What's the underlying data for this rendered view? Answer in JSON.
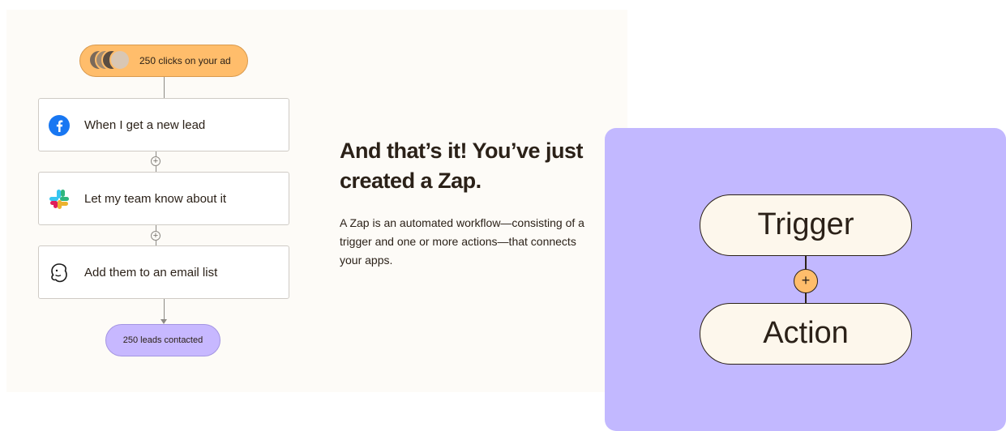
{
  "flow": {
    "trigger_pill": "250 clicks on your ad",
    "steps": [
      {
        "label": "When I get a new lead",
        "icon": "facebook-icon"
      },
      {
        "label": "Let my team know about it",
        "icon": "slack-icon"
      },
      {
        "label": "Add them to an email list",
        "icon": "mailchimp-icon"
      }
    ],
    "result_pill": "250 leads contacted"
  },
  "text": {
    "headline": "And that’s it! You’ve just created a Zap.",
    "body": "A Zap is an automated workflow—consisting of a trigger and one or more actions—that connects your apps."
  },
  "diagram": {
    "trigger": "Trigger",
    "action": "Action",
    "plus": "+"
  },
  "colors": {
    "orange": "#ffbd6b",
    "lavender": "#c2b8ff",
    "dark": "#2b2118",
    "cream": "#fdf7ec"
  }
}
